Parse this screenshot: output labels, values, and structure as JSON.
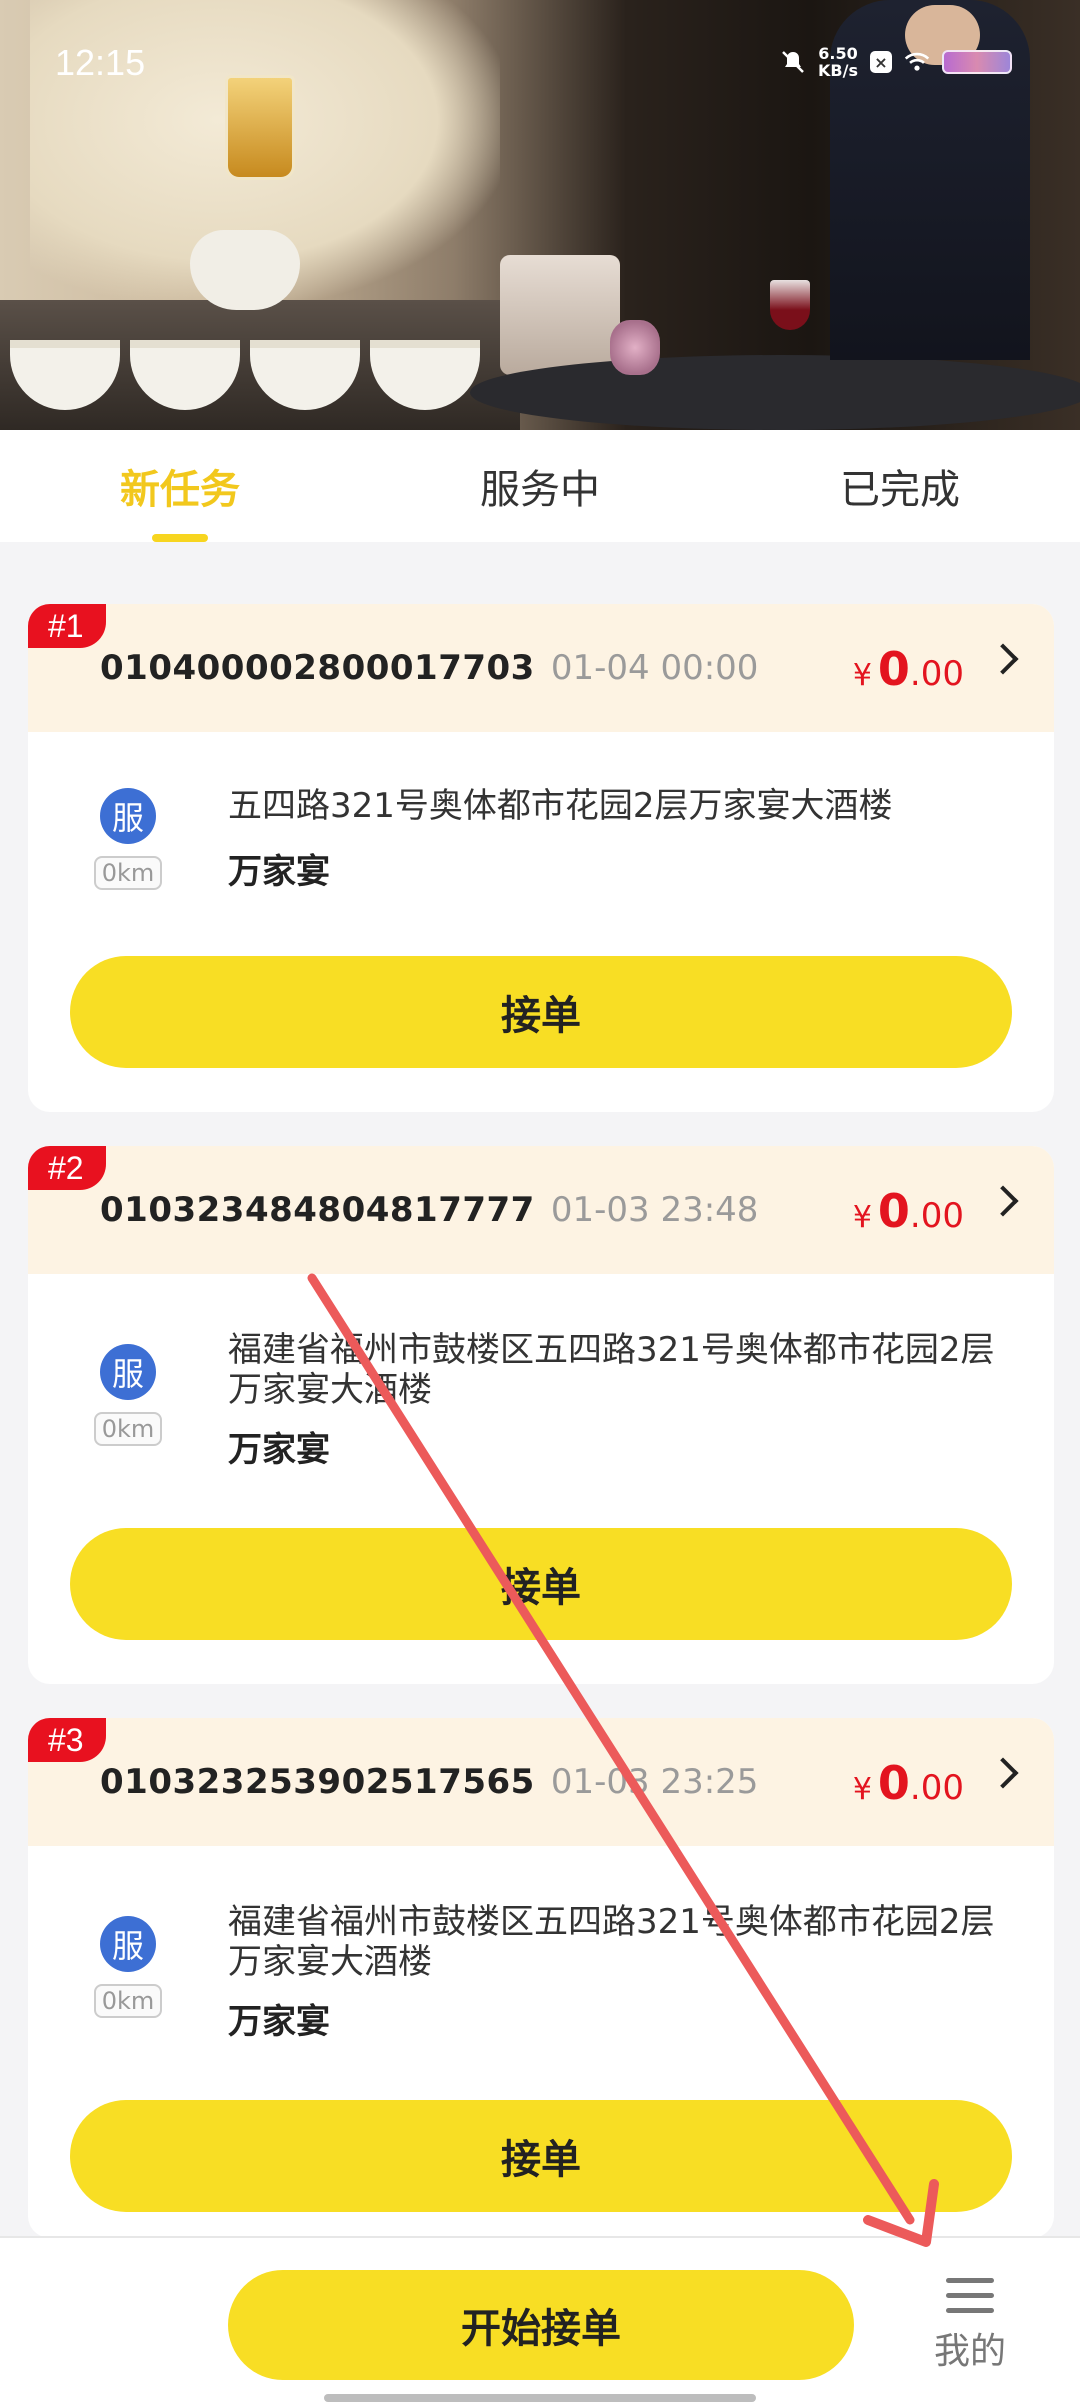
{
  "status_bar": {
    "time": "12:15",
    "net_speed_value": "6.50",
    "net_speed_unit": "KB/s"
  },
  "tabs": [
    {
      "label": "新任务",
      "active": true
    },
    {
      "label": "服务中",
      "active": false
    },
    {
      "label": "已完成",
      "active": false
    }
  ],
  "orders": [
    {
      "tag": "#1",
      "order_no": "010400002800017703",
      "time": "01-04 00:00",
      "currency": "¥",
      "price_int": "0",
      "price_dec": ".00",
      "service_badge": "服",
      "distance": "0km",
      "address": "五四路321号奥体都市花园2层万家宴大酒楼",
      "shop": "万家宴",
      "action": "接单"
    },
    {
      "tag": "#2",
      "order_no": "010323484804817777",
      "time": "01-03 23:48",
      "currency": "¥",
      "price_int": "0",
      "price_dec": ".00",
      "service_badge": "服",
      "distance": "0km",
      "address": "福建省福州市鼓楼区五四路321号奥体都市花园2层万家宴大酒楼",
      "shop": "万家宴",
      "action": "接单"
    },
    {
      "tag": "#3",
      "order_no": "010323253902517565",
      "time": "01-03 23:25",
      "currency": "¥",
      "price_int": "0",
      "price_dec": ".00",
      "service_badge": "服",
      "distance": "0km",
      "address": "福建省福州市鼓楼区五四路321号奥体都市花园2层万家宴大酒楼",
      "shop": "万家宴",
      "action": "接单"
    }
  ],
  "bottom_bar": {
    "start_button": "开始接单",
    "mine_label": "我的"
  },
  "colors": {
    "accent_yellow": "#f8de24",
    "tag_red": "#e8111f",
    "price_red": "#e3141f",
    "badge_blue": "#3d6fd4",
    "header_bg": "#fdf3e3",
    "annotation_arrow": "#ec5a5a"
  },
  "icons": [
    "mute-bell-icon",
    "wifi-icon",
    "battery-icon",
    "chevron-right-icon",
    "menu-icon"
  ]
}
